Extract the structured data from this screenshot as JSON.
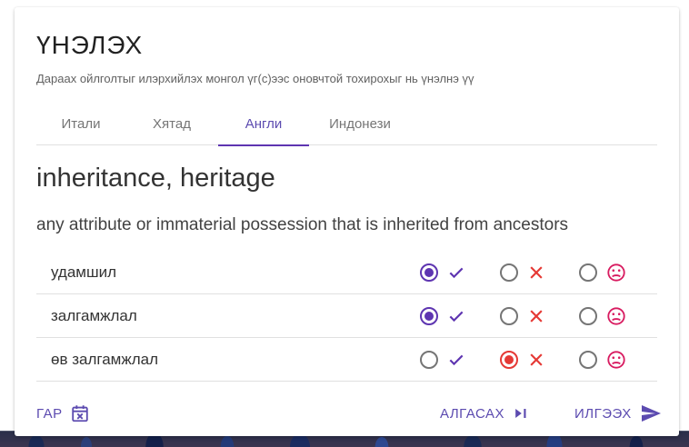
{
  "header": {
    "title": "ҮНЭЛЭХ",
    "subtitle": "Дараах ойлголтыг илэрхийлэх монгол үг(с)ээс оновчтой тохирохыг нь үнэлнэ үү"
  },
  "tabs": [
    {
      "label": "Итали"
    },
    {
      "label": "Хятад"
    },
    {
      "label": "Англи"
    },
    {
      "label": "Индонези"
    }
  ],
  "active_tab": "Англи",
  "concept": {
    "word": "inheritance, heritage",
    "definition": "any attribute or immaterial possession that is inherited from ancestors"
  },
  "options": [
    {
      "label": "удамшил",
      "selected": "good"
    },
    {
      "label": "залгамжлал",
      "selected": "good"
    },
    {
      "label": "өв залгамжлал",
      "selected": "bad"
    }
  ],
  "icons": {
    "good": "check-icon",
    "bad": "cross-icon",
    "unknown": "sad-face-icon"
  },
  "colors": {
    "accent": "#5e35b1",
    "bad": "#e53935",
    "unknown": "#d81b60"
  },
  "footer": {
    "later_label": "ГАР",
    "skip_label": "АЛГАСАХ",
    "send_label": "ИЛГЭЭХ"
  }
}
